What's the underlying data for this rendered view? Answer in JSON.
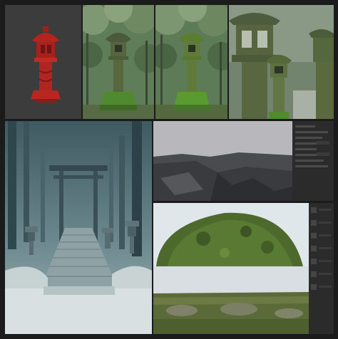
{
  "panels": {
    "render": "stone-lantern-3d-render",
    "forest1": "stone-lantern-forest-photo",
    "forest2": "stone-lantern-forest-photo-alt",
    "closeup": "stone-lantern-closeup",
    "scene": "misty-shrine-stairs-scene",
    "rock": "rock-surface-scan",
    "sphere": "moss-material-sphere",
    "ground": "moss-ground-material"
  },
  "colors": {
    "background": "#1b1b1b",
    "lantern_red": "#b3241f",
    "moss_green": "#4d6a2c",
    "fog_blue": "#5a7880",
    "ui_dark": "#2b2b2b"
  }
}
